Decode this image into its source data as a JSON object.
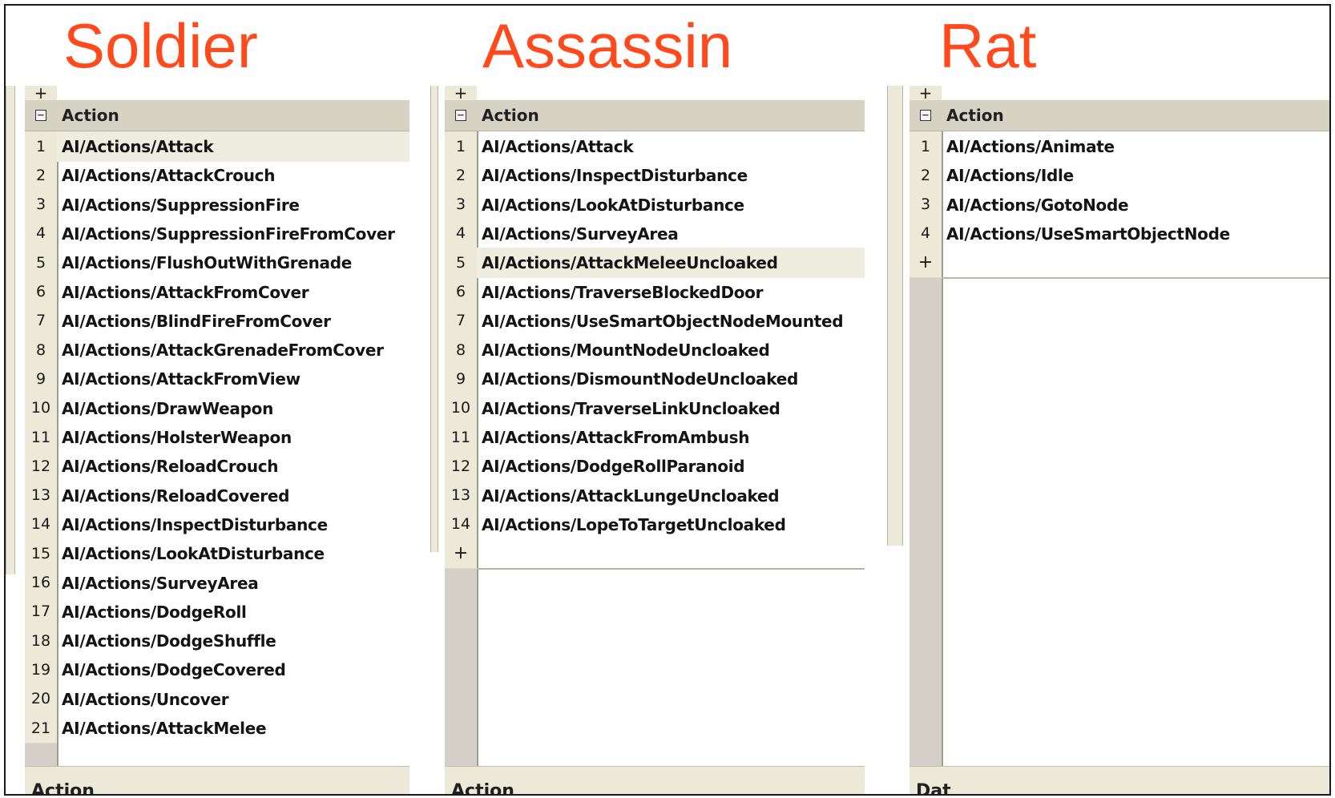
{
  "headings": {
    "soldier": "Soldier",
    "assassin": "Assassin",
    "rat": "Rat"
  },
  "common": {
    "group_label": "Action",
    "collapse_glyph": "⊟",
    "add_row_glyph": "+"
  },
  "accent_color": "#ff4a1e",
  "panels": {
    "soldier": {
      "rows": [
        {
          "num": "1",
          "value": "AI/Actions/Attack"
        },
        {
          "num": "2",
          "value": "AI/Actions/AttackCrouch"
        },
        {
          "num": "3",
          "value": "AI/Actions/SuppressionFire"
        },
        {
          "num": "4",
          "value": "AI/Actions/SuppressionFireFromCover"
        },
        {
          "num": "5",
          "value": "AI/Actions/FlushOutWithGrenade"
        },
        {
          "num": "6",
          "value": "AI/Actions/AttackFromCover"
        },
        {
          "num": "7",
          "value": "AI/Actions/BlindFireFromCover"
        },
        {
          "num": "8",
          "value": "AI/Actions/AttackGrenadeFromCover"
        },
        {
          "num": "9",
          "value": "AI/Actions/AttackFromView"
        },
        {
          "num": "10",
          "value": "AI/Actions/DrawWeapon"
        },
        {
          "num": "11",
          "value": "AI/Actions/HolsterWeapon"
        },
        {
          "num": "12",
          "value": "AI/Actions/ReloadCrouch"
        },
        {
          "num": "13",
          "value": "AI/Actions/ReloadCovered"
        },
        {
          "num": "14",
          "value": "AI/Actions/InspectDisturbance"
        },
        {
          "num": "15",
          "value": "AI/Actions/LookAtDisturbance"
        },
        {
          "num": "16",
          "value": "AI/Actions/SurveyArea"
        },
        {
          "num": "17",
          "value": "AI/Actions/DodgeRoll"
        },
        {
          "num": "18",
          "value": "AI/Actions/DodgeShuffle"
        },
        {
          "num": "19",
          "value": "AI/Actions/DodgeCovered"
        },
        {
          "num": "20",
          "value": "AI/Actions/Uncover"
        },
        {
          "num": "21",
          "value": "AI/Actions/AttackMelee"
        }
      ],
      "selected_row": "1",
      "footer_label": "Action"
    },
    "assassin": {
      "rows": [
        {
          "num": "1",
          "value": "AI/Actions/Attack"
        },
        {
          "num": "2",
          "value": "AI/Actions/InspectDisturbance"
        },
        {
          "num": "3",
          "value": "AI/Actions/LookAtDisturbance"
        },
        {
          "num": "4",
          "value": "AI/Actions/SurveyArea"
        },
        {
          "num": "5",
          "value": "AI/Actions/AttackMeleeUncloaked"
        },
        {
          "num": "6",
          "value": "AI/Actions/TraverseBlockedDoor"
        },
        {
          "num": "7",
          "value": "AI/Actions/UseSmartObjectNodeMounted"
        },
        {
          "num": "8",
          "value": "AI/Actions/MountNodeUncloaked"
        },
        {
          "num": "9",
          "value": "AI/Actions/DismountNodeUncloaked"
        },
        {
          "num": "10",
          "value": "AI/Actions/TraverseLinkUncloaked"
        },
        {
          "num": "11",
          "value": "AI/Actions/AttackFromAmbush"
        },
        {
          "num": "12",
          "value": "AI/Actions/DodgeRollParanoid"
        },
        {
          "num": "13",
          "value": "AI/Actions/AttackLungeUncloaked"
        },
        {
          "num": "14",
          "value": "AI/Actions/LopeToTargetUncloaked"
        }
      ],
      "selected_row": "5",
      "footer_label": "Action"
    },
    "rat": {
      "rows": [
        {
          "num": "1",
          "value": "AI/Actions/Animate"
        },
        {
          "num": "2",
          "value": "AI/Actions/Idle"
        },
        {
          "num": "3",
          "value": "AI/Actions/GotoNode"
        },
        {
          "num": "4",
          "value": "AI/Actions/UseSmartObjectNode"
        }
      ],
      "selected_row": "",
      "footer_label": "Dat"
    }
  }
}
